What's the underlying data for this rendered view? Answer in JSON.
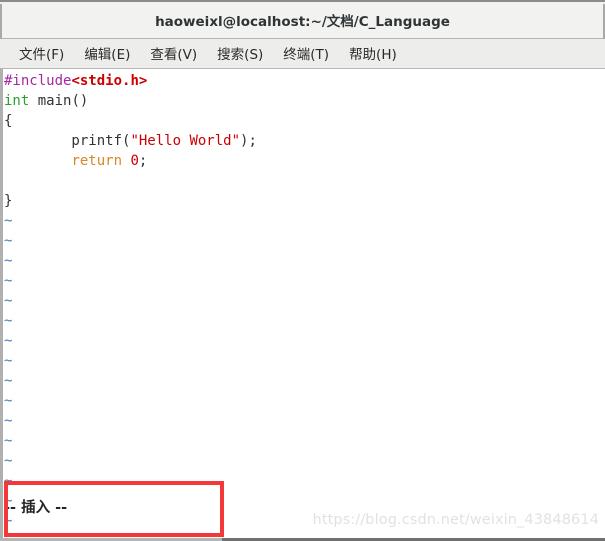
{
  "window": {
    "title": "haoweixl@localhost:~/文档/C_Language"
  },
  "menubar": {
    "items": [
      {
        "label": "文件(F)"
      },
      {
        "label": "编辑(E)"
      },
      {
        "label": "查看(V)"
      },
      {
        "label": "搜索(S)"
      },
      {
        "label": "终端(T)"
      },
      {
        "label": "帮助(H)"
      }
    ]
  },
  "editor": {
    "filler_char": "~",
    "filler_count": 16,
    "code_lines": [
      {
        "tokens": [
          {
            "text": "#include",
            "type": "preprocessor"
          },
          {
            "text": "<stdio.h>",
            "type": "include"
          }
        ]
      },
      {
        "tokens": [
          {
            "text": "int",
            "type": "type"
          },
          {
            "text": " main()",
            "type": "plain"
          }
        ]
      },
      {
        "tokens": [
          {
            "text": "{",
            "type": "plain"
          }
        ]
      },
      {
        "tokens": [
          {
            "text": "        printf(",
            "type": "plain"
          },
          {
            "text": "\"Hello World\"",
            "type": "string"
          },
          {
            "text": ");",
            "type": "plain"
          }
        ]
      },
      {
        "tokens": [
          {
            "text": "        ",
            "type": "plain"
          },
          {
            "text": "return",
            "type": "keyword"
          },
          {
            "text": " ",
            "type": "plain"
          },
          {
            "text": "0",
            "type": "number"
          },
          {
            "text": ";",
            "type": "plain"
          }
        ]
      },
      {
        "tokens": [
          {
            "text": "",
            "type": "plain"
          }
        ]
      },
      {
        "tokens": [
          {
            "text": "}",
            "type": "plain"
          }
        ]
      }
    ]
  },
  "status": {
    "mode_text": "-- 插入 --"
  },
  "annotation": {
    "present": true,
    "color": "#f4383a"
  },
  "watermark": {
    "text": "https://blog.csdn.net/weixin_43848614"
  },
  "colors": {
    "titlebar_bg": "#f2f2f0",
    "menubar_bg": "#ededeb",
    "terminal_bg": "#ffffff",
    "preprocessor": "#a626a4",
    "include": "#cc0000",
    "type": "#2f9e2f",
    "string": "#cc0000",
    "keyword": "#d98724",
    "number": "#cc0000",
    "tilde": "#4a7ab5",
    "annotation": "#f4383a"
  }
}
